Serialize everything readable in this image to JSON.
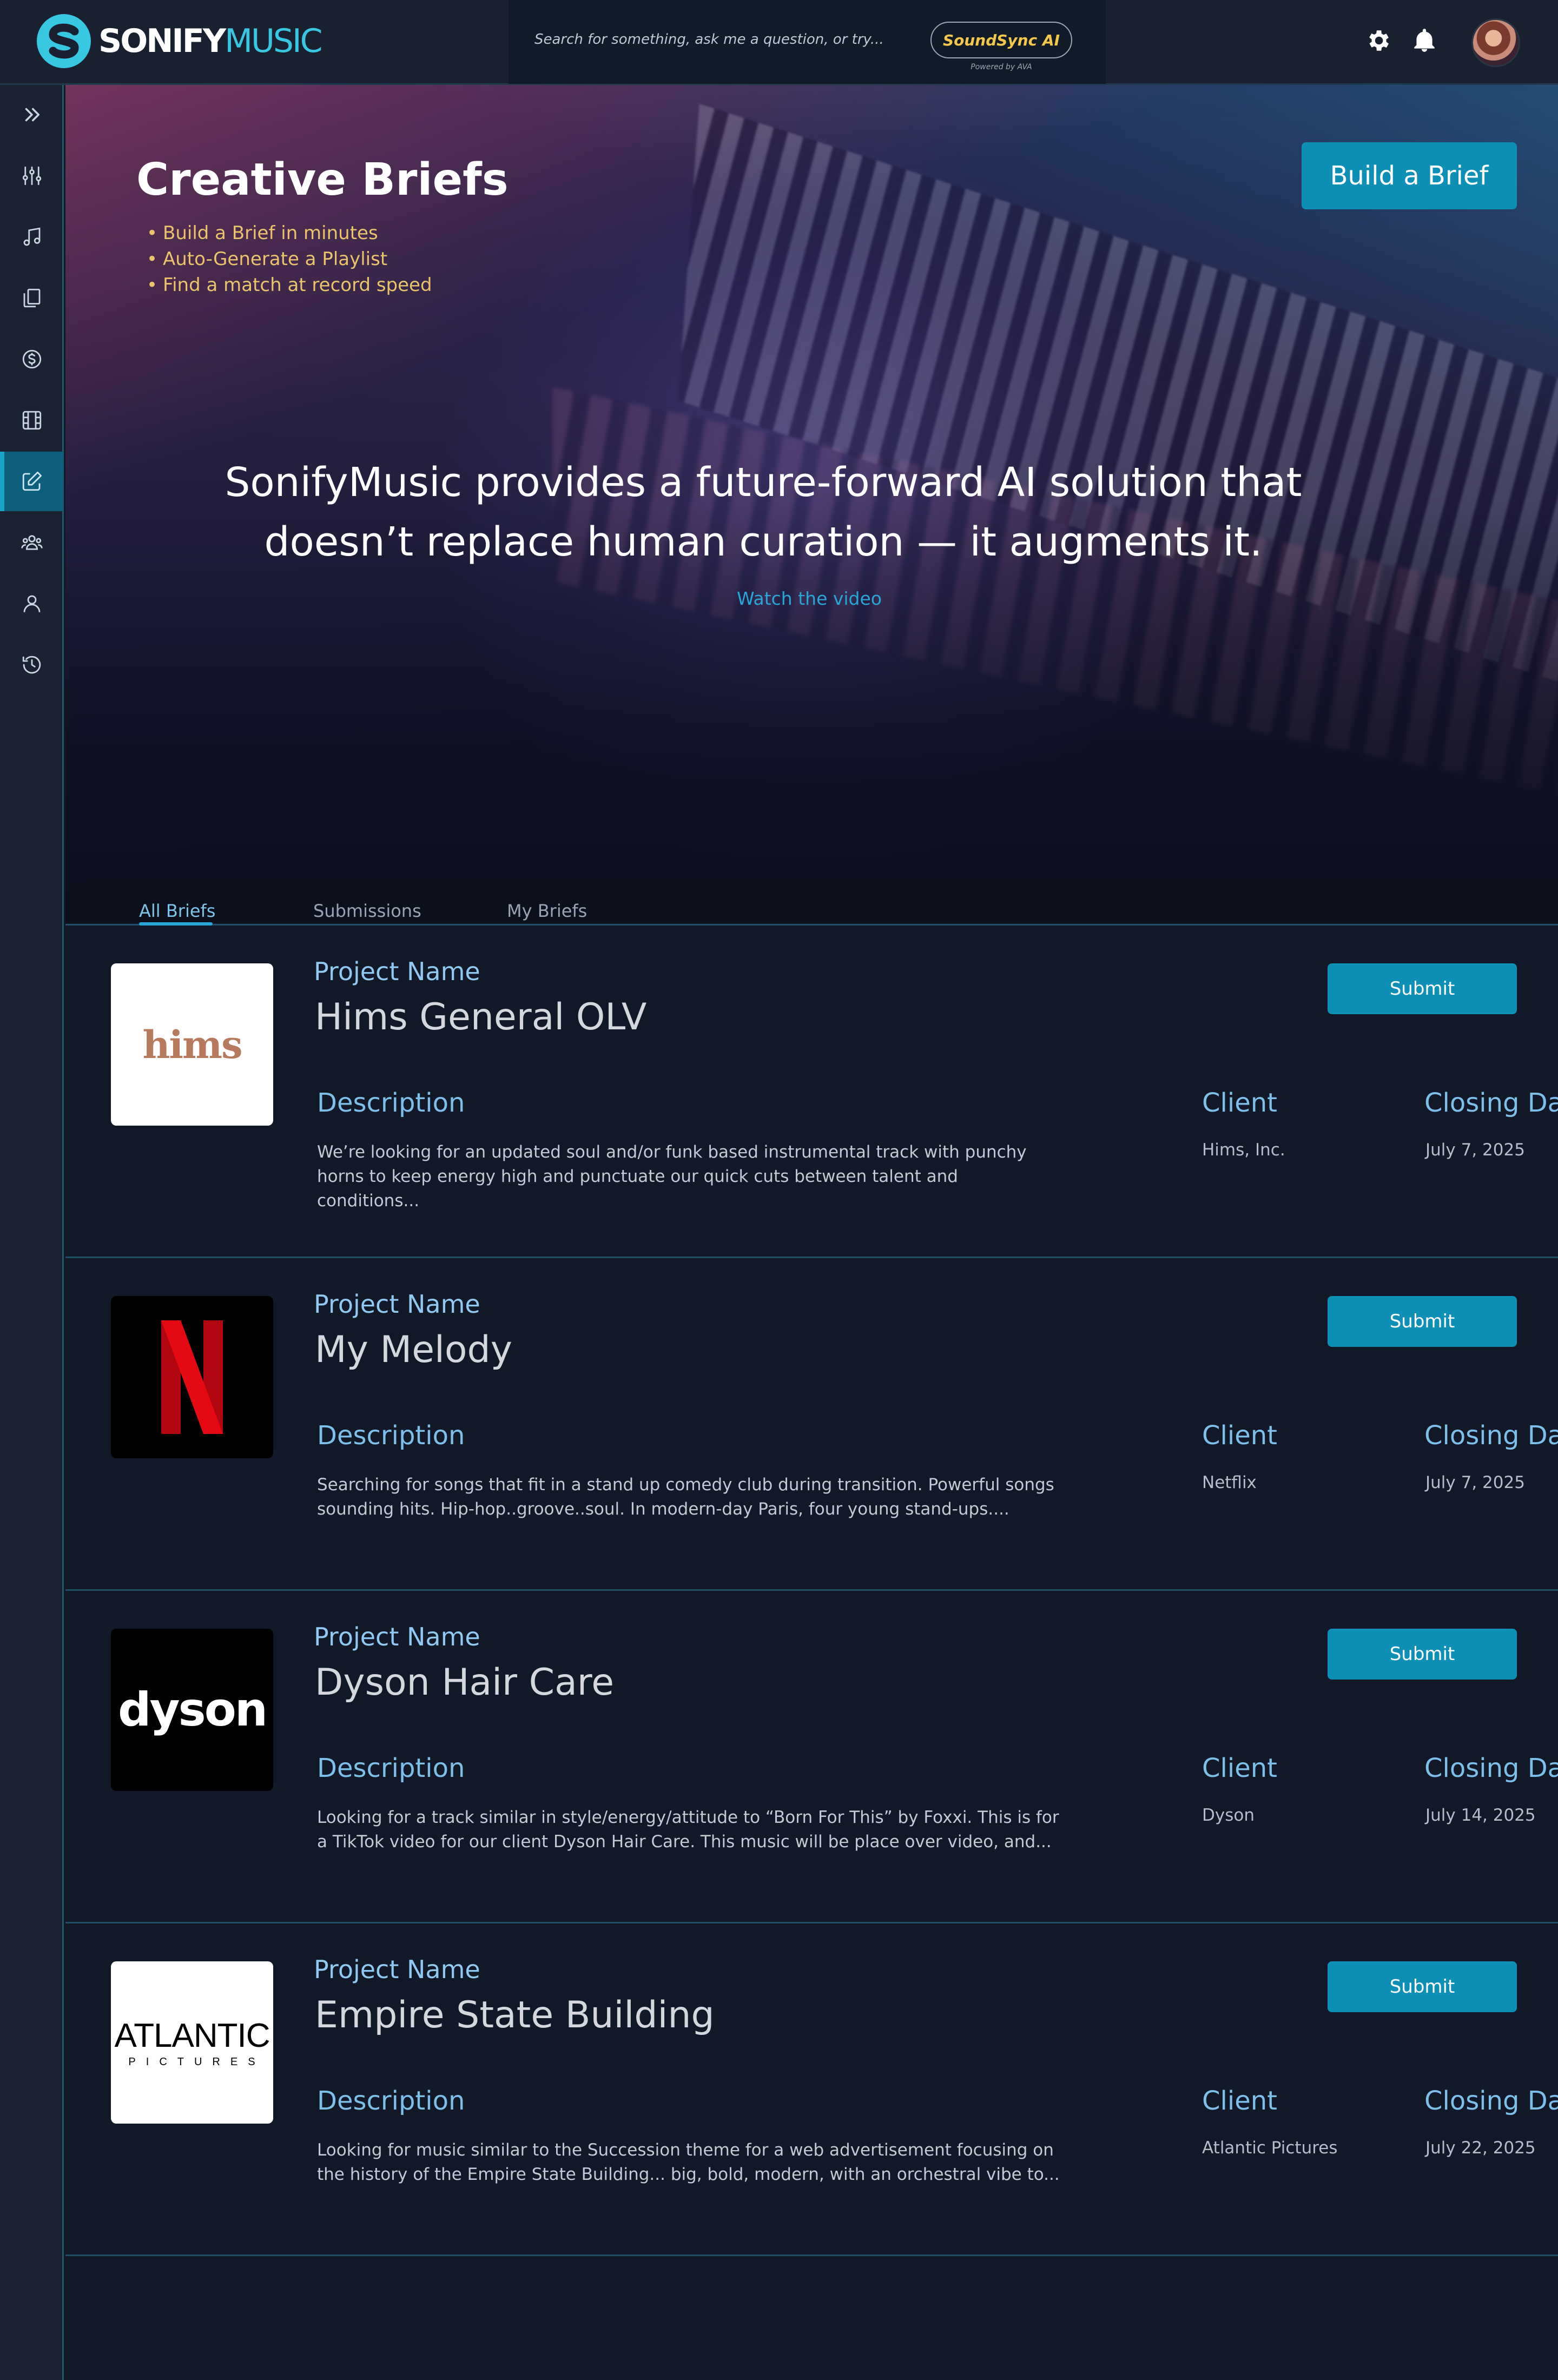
{
  "app": {
    "logo_part1": "SONIFY",
    "logo_part2": "MUSIC",
    "accent_color": "#38c7e0",
    "button_color": "#0e8fb5"
  },
  "search": {
    "placeholder": "Search for something, ask me a question, or try...",
    "ai_button_label": "SoundSync AI",
    "ai_powered_by": "Powered by AVA"
  },
  "header_icons": [
    "gear-icon",
    "bell-icon",
    "user-avatar"
  ],
  "sidebar": {
    "items": [
      {
        "icon": "chevrons-right-icon",
        "active": false
      },
      {
        "icon": "sliders-icon",
        "active": false
      },
      {
        "icon": "music-note-icon",
        "active": false
      },
      {
        "icon": "copy-icon",
        "active": false
      },
      {
        "icon": "dollar-icon",
        "active": false
      },
      {
        "icon": "film-icon",
        "active": false
      },
      {
        "icon": "edit-icon",
        "active": true
      },
      {
        "icon": "users-icon",
        "active": false
      },
      {
        "icon": "user-icon",
        "active": false
      },
      {
        "icon": "history-icon",
        "active": false
      }
    ]
  },
  "hero": {
    "title": "Creative Briefs",
    "bullets": [
      "Build a Brief in minutes",
      "Auto-Generate a Playlist",
      "Find a match at record speed"
    ],
    "build_button": "Build a Brief",
    "tagline_line1": "SonifyMusic provides a future-forward AI solution that",
    "tagline_line2": "doesn’t replace human curation — it augments it.",
    "video_link": "Watch the video"
  },
  "tabs": [
    {
      "label": "All Briefs",
      "active": true
    },
    {
      "label": "Submissions",
      "active": false
    },
    {
      "label": "My Briefs",
      "active": false
    }
  ],
  "brief_labels": {
    "project_name": "Project Name",
    "description": "Description",
    "client": "Client",
    "closing_date": "Closing Date",
    "submit": "Submit"
  },
  "briefs": [
    {
      "logo_text": "hims",
      "project_name": "Hims General OLV",
      "description": "We’re looking for an updated soul and/or funk based instrumental track with punchy horns to keep energy high and punctuate our quick cuts between talent and conditions...",
      "client": "Hims, Inc.",
      "closing_date": "July 7, 2025"
    },
    {
      "logo_text": "N",
      "project_name": "My Melody",
      "description": "Searching for songs that fit in a stand up comedy club during transition. Powerful songs sounding hits. Hip-hop..groove..soul. In modern-day Paris, four young stand-ups....",
      "client": "Netflix",
      "closing_date": "July 7, 2025"
    },
    {
      "logo_text": "dyson",
      "project_name": "Dyson Hair Care",
      "description": "Looking for a track similar in style/energy/attitude to “Born For This” by Foxxi. This is for a TikTok video for our client Dyson Hair Care. This music will be place over video, and...",
      "client": "Dyson",
      "closing_date": "July 14, 2025"
    },
    {
      "logo_text": "ATLANTIC",
      "logo_subtext": "PICTURES",
      "project_name": "Empire State Building",
      "description": "Looking for music similar to the Succession theme for a web advertisement focusing on the history of the Empire State Building... big, bold, modern, with an orchestral vibe to...",
      "client": "Atlantic Pictures",
      "closing_date": "July 22, 2025"
    }
  ]
}
